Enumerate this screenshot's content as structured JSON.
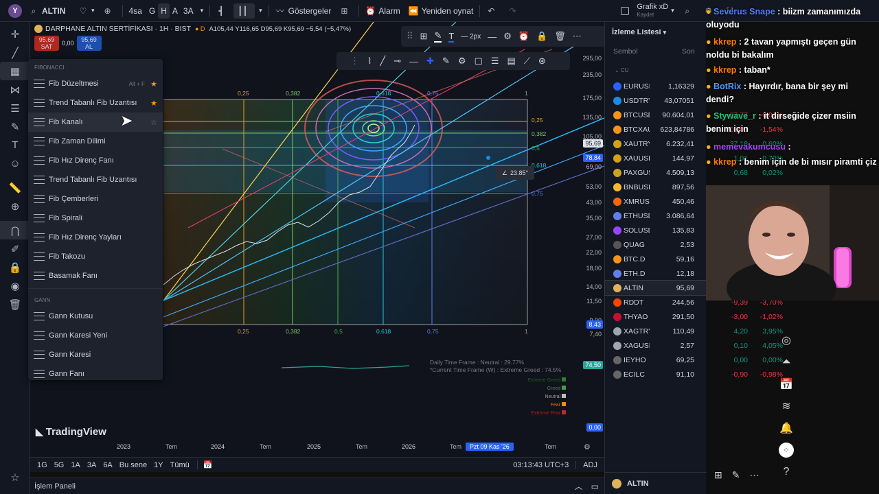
{
  "topbar": {
    "symbol": "ALTIN",
    "interval_4sa": "4sa",
    "interval_g": "G",
    "interval_h": "H",
    "interval_a": "A",
    "interval_3a": "3A",
    "indicators": "Göstergeler",
    "alarm": "Alarm",
    "replay": "Yeniden oynat",
    "layout_name": "Grafik xD",
    "layout_status": "Kaydet"
  },
  "legend": {
    "title": "DARPHANE ALTIN SERTİFİKASI · 1H · BIST",
    "ohlc": "A105,44  Y116,65  D95,69  K95,69  −5,54 (−5,47%)",
    "sell_price": "95,69",
    "sell_label": "SAT",
    "spread": "0,00",
    "buy_price": "95,69",
    "buy_label": "AL"
  },
  "drawing_toolbar": {
    "width_label": "2px"
  },
  "menu": {
    "section_fib": "FIBONACCI",
    "fib_items": [
      {
        "label": "Fib Düzeltmesi",
        "shortcut": "Alt + F",
        "fav": true
      },
      {
        "label": "Trend Tabanlı Fib Uzantısı",
        "fav": true
      },
      {
        "label": "Fib Kanalı",
        "fav": false,
        "hover": true
      },
      {
        "label": "Fib Zaman Dilimi"
      },
      {
        "label": "Fib Hız Direnç Fanı"
      },
      {
        "label": "Trend Tabanlı Fib Uzantısı"
      },
      {
        "label": "Fib Çemberleri"
      },
      {
        "label": "Fib Spirali"
      },
      {
        "label": "Fib Hız Direnç Yayları"
      },
      {
        "label": "Fib Takozu"
      },
      {
        "label": "Basamak Fanı"
      }
    ],
    "section_gann": "GANN",
    "gann_items": [
      {
        "label": "Gann Kutusu"
      },
      {
        "label": "Gann Karesi Yeni"
      },
      {
        "label": "Gann Karesi"
      },
      {
        "label": "Gann Fanı"
      }
    ]
  },
  "price_axis": [
    "295,00",
    "235,00",
    "175,00",
    "135,00",
    "105,00",
    "69,00",
    "53,00",
    "43,00",
    "35,00",
    "27,00",
    "22,00",
    "18,00",
    "14,00",
    "11,50",
    "9,00",
    "7,40"
  ],
  "price_labels": {
    "current": "95,69",
    "line": "78,84",
    "low": "8,43",
    "osc": "74,50",
    "zero": "0,00"
  },
  "fib_levels_top": [
    "0,25",
    "0,382",
    "0,618",
    "0,75",
    "1"
  ],
  "fib_levels_right": [
    "0,25",
    "0,382",
    "0,5",
    "0,618",
    "0,75",
    "1"
  ],
  "fib_levels_bottom": [
    "0,25",
    "0,382",
    "0,5",
    "0,618",
    "0,75",
    "1"
  ],
  "angle_label": "23.85°",
  "indicator_text": {
    "line1": "Daily Time Frame : Neutral : 29.77%",
    "line2": "*Current Time Frame (W) : Extreme Greed : 74.5%",
    "legend": [
      "Extreme Greed",
      "Greed",
      "Neutral",
      "Fear",
      "Extreme Fear"
    ]
  },
  "watermark": "TradingView",
  "time_axis": [
    "2023",
    "Tem",
    "2024",
    "Tem",
    "2025",
    "Tem",
    "2026",
    "Tem",
    "Tem"
  ],
  "time_cursor": "Pzt 09 Kas '26",
  "ranges": [
    "1G",
    "5G",
    "1A",
    "3A",
    "6A",
    "Bu sene",
    "1Y",
    "Tümü"
  ],
  "clock": "03:13:43 UTC+3",
  "adj": "ADJ",
  "panel_label": "İşlem Paneli",
  "watchlist": {
    "title": "İzleme Listesi",
    "col_symbol": "Sembol",
    "col_last": "Son",
    "group": "CU",
    "rows": [
      {
        "sym": "EURUSD",
        "last": "1,16329",
        "color": "#2962ff"
      },
      {
        "sym": "USDTRY",
        "last": "43,07051",
        "color": "#1e88e5"
      },
      {
        "sym": "BTCUSDT",
        "last": "90.604,01",
        "color": "#f7931a",
        "chg": "-37,77",
        "pct": "-0,04%"
      },
      {
        "sym": "BTCXAU",
        "last": "623,84786",
        "color": "#f7931a",
        "chg": "-0,200",
        "pct": "-1,54%"
      },
      {
        "sym": "XAUTRY",
        "last": "6.232,41",
        "color": "#d4a017",
        "chg": "37,18",
        "pct": "0,60%"
      },
      {
        "sym": "XAUUSD",
        "last": "144,97",
        "color": "#d4a017",
        "chg": "1,01",
        "pct": "0,70%"
      },
      {
        "sym": "PAXGUSD",
        "last": "4.509,13",
        "color": "#c9a227",
        "chg": "0,68",
        "pct": "0,02%"
      },
      {
        "sym": "BNBUSDT",
        "last": "897,56",
        "color": "#f3ba2f"
      },
      {
        "sym": "XMRUST",
        "last": "450,46",
        "color": "#ff6600"
      },
      {
        "sym": "ETHUSDT",
        "last": "3.086,64",
        "color": "#627eea"
      },
      {
        "sym": "SOLUSDT",
        "last": "135,83",
        "color": "#9945ff"
      },
      {
        "sym": "QUAG",
        "last": "2,53",
        "color": "#555"
      },
      {
        "sym": "BTC.D",
        "last": "59,16",
        "color": "#f7931a"
      },
      {
        "sym": "ETH.D",
        "last": "12,18",
        "color": "#627eea"
      },
      {
        "sym": "ALTIN",
        "last": "95,69",
        "color": "#e0b25b",
        "selected": true
      },
      {
        "sym": "RDDT",
        "last": "244,56",
        "color": "#ff4500",
        "chg": "-9,39",
        "pct": "-3,70%"
      },
      {
        "sym": "THYAO",
        "last": "291,50",
        "color": "#c8102e",
        "chg": "-3,00",
        "pct": "-1,02%"
      },
      {
        "sym": "XAGTRY",
        "last": "110,49",
        "color": "#9ea7b0",
        "chg": "4,20",
        "pct": "3,95%"
      },
      {
        "sym": "XAGUSD",
        "last": "2,57",
        "color": "#9ea7b0",
        "chg": "0,10",
        "pct": "4,05%"
      },
      {
        "sym": "IEYHO",
        "last": "69,25",
        "color": "#666",
        "chg": "0,00",
        "pct": "0,00%"
      },
      {
        "sym": "ECILC",
        "last": "91,10",
        "color": "#666",
        "chg": "-0,90",
        "pct": "-0,98%"
      }
    ],
    "footer_symbol": "ALTIN"
  },
  "chat": [
    {
      "user": "Severus Snape",
      "text": ": biizm zamanımızda oluyodu",
      "color": "#4d7cfe"
    },
    {
      "user": "kkrep",
      "text": ": 2 tavan yapmıştı geçen gün noldu bi bakalım",
      "color": "#ff7a00"
    },
    {
      "user": "kkrep",
      "text": ": taban*",
      "color": "#ff7a00"
    },
    {
      "user": "BotRix",
      "text": ": Hayırdır, bana bir şey mi dendi?",
      "color": "#4d9cff"
    },
    {
      "user": "Stywave_r",
      "text": ": it dirseğide çizer msiin benim için",
      "color": "#19c37d"
    },
    {
      "user": "memevakumcusu",
      "text": ":",
      "color": "#a445ff"
    },
    {
      "user": "kkrep",
      "text": ": benim için de bi mısır piramti çiz",
      "color": "#ff7a00"
    }
  ]
}
